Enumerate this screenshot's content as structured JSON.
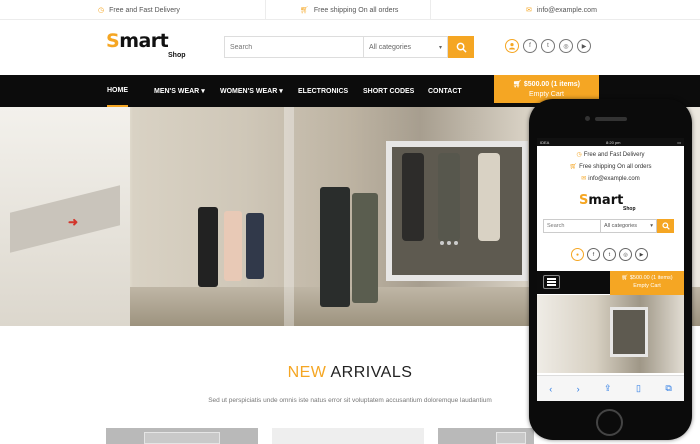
{
  "topbar": {
    "delivery": "Free and Fast Delivery",
    "shipping": "Free shipping On all orders",
    "email": "info@example.com"
  },
  "brand": {
    "name_accent": "S",
    "name_rest": "mart",
    "sub": "Shop",
    "accent_color": "#f5a623"
  },
  "search": {
    "placeholder": "Search",
    "category": "All categories"
  },
  "nav": {
    "items": [
      "HOME",
      "MEN'S WEAR",
      "WOMEN'S WEAR",
      "ELECTRONICS",
      "SHORT CODES",
      "CONTACT"
    ],
    "dropdown_marker": "▾"
  },
  "cart": {
    "amount": "$500.00 (1 items)",
    "empty_label": "Empty Cart"
  },
  "arrivals": {
    "title_accent": "NEW",
    "title_rest": " ARRIVALS",
    "description": "Sed ut perspiciatis unde omnis iste natus error sit voluptatem accusantium doloremque laudantium"
  },
  "phone": {
    "carrier": "IDEA",
    "time": "8:20 pm",
    "delivery": "Free and Fast Delivery",
    "shipping": "Free shipping On all orders",
    "email": "info@example.com",
    "search_placeholder": "Search",
    "category": "All categories",
    "cart_amount": "$500.00 (1 items)",
    "cart_empty": "Empty Cart"
  },
  "icons": [
    "truck-icon",
    "cart-icon",
    "envelope-icon",
    "search-icon",
    "user-icon",
    "facebook-icon",
    "twitter-icon",
    "instagram-icon",
    "youtube-icon",
    "menu-icon"
  ]
}
